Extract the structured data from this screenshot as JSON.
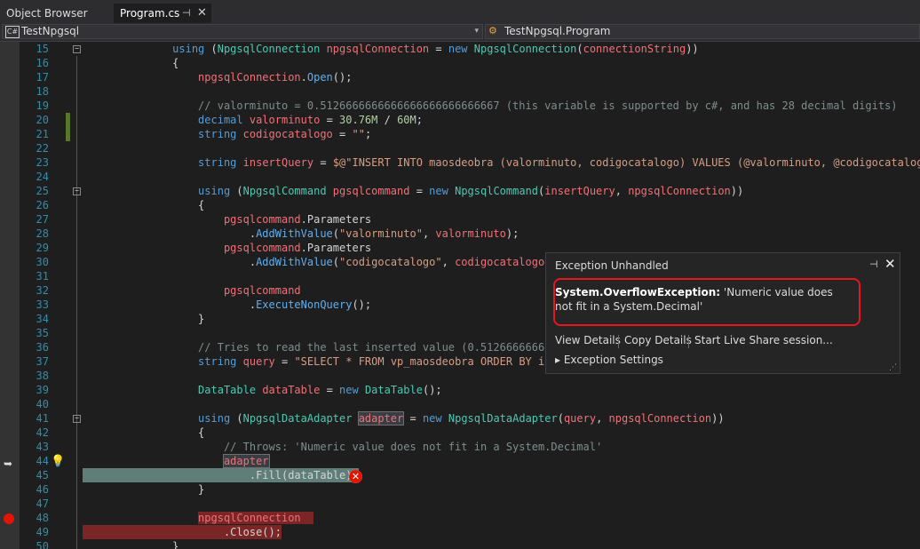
{
  "tabs": {
    "object_browser": "Object Browser",
    "program": "Program.cs",
    "pin_icon": "⊣",
    "close_icon": "✕"
  },
  "nav": {
    "project": "TestNpgsql",
    "project_icon": "C#",
    "member": "TestNpgsql.Program"
  },
  "editor": {
    "line_numbers": [
      "15",
      "16",
      "17",
      "18",
      "19",
      "20",
      "21",
      "22",
      "23",
      "24",
      "25",
      "26",
      "27",
      "28",
      "29",
      "30",
      "31",
      "32",
      "33",
      "34",
      "35",
      "36",
      "37",
      "38",
      "39",
      "40",
      "41",
      "42",
      "43",
      "44",
      "45",
      "46",
      "47",
      "48",
      "49",
      "50"
    ],
    "current_line": "44",
    "breakpoint_line": "48",
    "colors": {
      "background": "#1e1e1e",
      "current_statement": "#5f7e77",
      "breakpoint": "#7a2626",
      "line_number": "#2b91af"
    }
  },
  "exception": {
    "title": "Exception Unhandled",
    "type": "System.OverflowException:",
    "message": " 'Numeric value does not fit in a System.Decimal'",
    "view_details": "View Details",
    "copy_details": "Copy Details",
    "live_share": "Start Live Share session...",
    "settings": "Exception Settings"
  }
}
